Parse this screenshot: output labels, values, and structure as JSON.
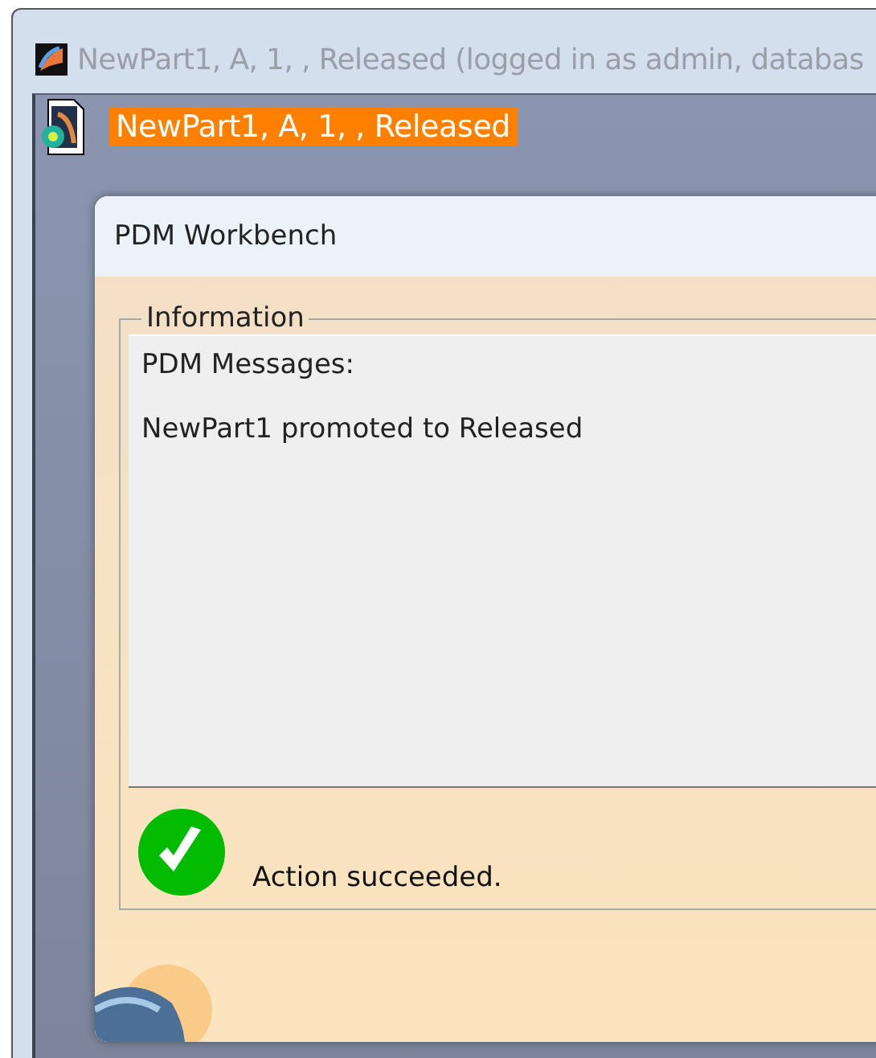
{
  "window": {
    "title": "NewPart1, A, 1, , Released (logged in as admin, databas"
  },
  "tree": {
    "items": [
      {
        "label": "NewPart1, A, 1, , Released",
        "selected": true
      }
    ]
  },
  "dialog": {
    "title": "PDM Workbench",
    "group_label": "Information",
    "messages": [
      "PDM Messages:",
      "NewPart1 promoted to Released"
    ],
    "status": {
      "kind": "success",
      "text": "Action succeeded."
    }
  }
}
